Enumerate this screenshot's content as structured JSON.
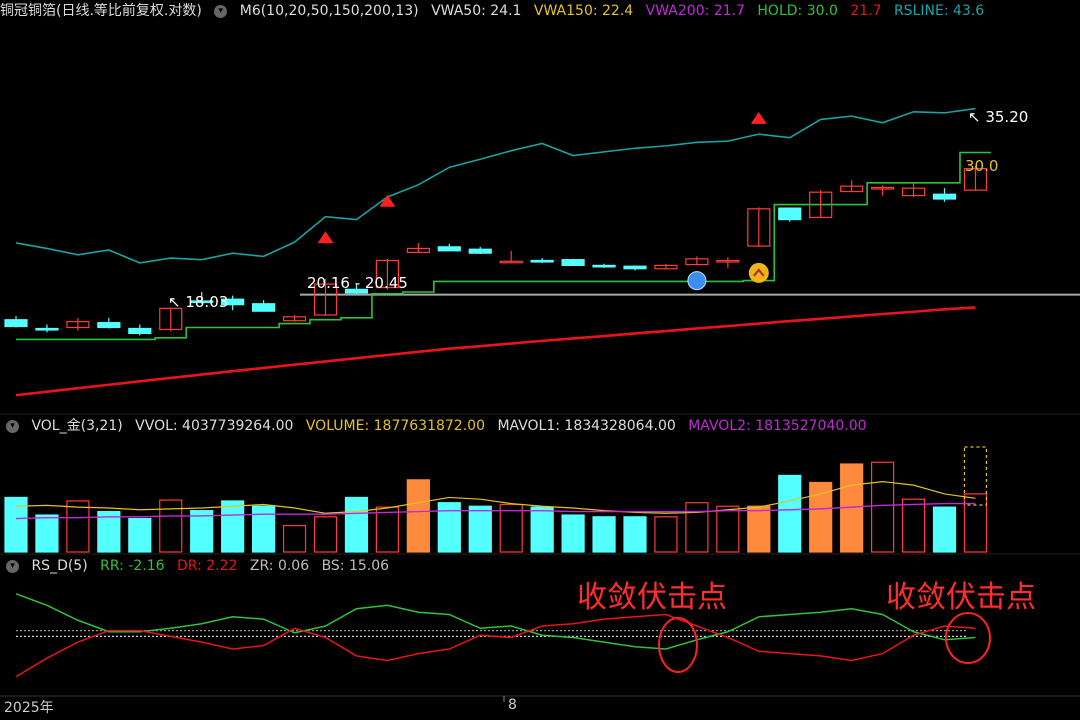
{
  "header_main": {
    "title": "铜冠铜箔(日线.等比前复权.对数)",
    "indicator": "M6(10,20,50,150,200,13)",
    "vwa50": "VWA50: 24.1",
    "vwa150": "VWA150: 22.4",
    "vwa200": "VWA200: 21.7",
    "hold": "HOLD: 30.0",
    "hold2": "21.7",
    "rsline": "RSLINE: 43.6"
  },
  "header_vol": {
    "name": "VOL_金(3,21)",
    "vvol": "VVOL: 4037739264.00",
    "volume": "VOLUME: 1877631872.00",
    "mavol1": "MAVOL1: 1834328064.00",
    "mavol2": "MAVOL2: 1813527040.00"
  },
  "header_rs": {
    "name": "RS_D(5)",
    "rr": "RR: -2.16",
    "dr": "DR: 2.22",
    "zr": "ZR: 0.06",
    "bs": "BS: 15.06"
  },
  "labels": {
    "low": "18.03",
    "range": "20.16 - 20.45",
    "high": "35.20",
    "hold_val": "30.0",
    "annotation1": "收敛伏击点",
    "annotation2": "收敛伏击点",
    "x_year": "2025年",
    "x_tick": "8"
  },
  "colors": {
    "up": "#ff3b3b",
    "down": "#54ffff",
    "hot": "#ff8a3d",
    "teal": "#1aa3a3",
    "green": "#2fc33a",
    "red": "#e8141a",
    "yellow": "#e6c31e",
    "purple": "#c02bd6",
    "grey": "#bdbdbd"
  },
  "chart_data": [
    {
      "type": "candlestick",
      "x": [
        1,
        2,
        3,
        4,
        5,
        6,
        7,
        8,
        9,
        10,
        11,
        12,
        13,
        14,
        15,
        16,
        17,
        18,
        19,
        20,
        21,
        22,
        23,
        24,
        25,
        26,
        27,
        28,
        29,
        30,
        31,
        32
      ],
      "ohlc": [
        [
          18.95,
          19.15,
          18.55,
          18.6
        ],
        [
          18.5,
          18.7,
          18.3,
          18.45
        ],
        [
          18.55,
          19.05,
          18.4,
          18.85
        ],
        [
          18.8,
          19.05,
          18.5,
          18.55
        ],
        [
          18.5,
          18.7,
          18.15,
          18.25
        ],
        [
          18.45,
          19.6,
          18.35,
          19.55
        ],
        [
          19.95,
          20.45,
          19.8,
          19.9
        ],
        [
          20.05,
          20.25,
          19.45,
          19.75
        ],
        [
          19.8,
          20.0,
          19.4,
          19.4
        ],
        [
          18.9,
          19.2,
          18.85,
          19.1
        ],
        [
          19.2,
          21.2,
          19.15,
          20.9
        ],
        [
          20.6,
          20.9,
          20.35,
          20.4
        ],
        [
          20.7,
          22.4,
          20.6,
          22.3
        ],
        [
          22.8,
          23.4,
          22.75,
          23.05
        ],
        [
          23.15,
          23.35,
          22.9,
          22.9
        ],
        [
          23.0,
          23.15,
          22.7,
          22.75
        ],
        [
          22.25,
          22.9,
          22.2,
          22.25
        ],
        [
          22.3,
          22.45,
          22.15,
          22.25
        ],
        [
          22.35,
          22.4,
          22.0,
          22.0
        ],
        [
          22.0,
          22.1,
          21.85,
          21.95
        ],
        [
          21.95,
          22.0,
          21.7,
          21.8
        ],
        [
          21.8,
          22.1,
          21.75,
          22.0
        ],
        [
          22.05,
          22.55,
          22.0,
          22.4
        ],
        [
          22.3,
          22.5,
          21.85,
          22.3
        ],
        [
          23.2,
          25.8,
          23.15,
          25.7
        ],
        [
          25.75,
          25.8,
          24.8,
          24.95
        ],
        [
          25.1,
          27.05,
          25.05,
          26.9
        ],
        [
          26.95,
          27.8,
          26.9,
          27.35
        ],
        [
          27.2,
          27.4,
          26.65,
          27.25
        ],
        [
          26.65,
          27.6,
          26.55,
          27.2
        ],
        [
          26.75,
          27.2,
          26.2,
          26.4
        ],
        [
          27.05,
          28.9,
          27.0,
          28.7
        ]
      ],
      "series": [
        {
          "name": "RSLINE",
          "values": [
            23.4,
            23.05,
            22.65,
            22.95,
            22.15,
            22.45,
            22.35,
            22.75,
            22.55,
            23.45,
            25.15,
            24.95,
            26.55,
            27.45,
            28.8,
            29.45,
            30.15,
            30.75,
            29.75,
            30.05,
            30.35,
            30.55,
            30.85,
            30.95,
            31.55,
            31.25,
            32.85,
            33.15,
            32.55,
            33.55,
            33.45,
            33.85
          ]
        },
        {
          "name": "HOLD",
          "values": [
            17.95,
            17.95,
            17.95,
            17.95,
            17.95,
            18.03,
            18.55,
            18.55,
            18.55,
            18.75,
            18.95,
            19.05,
            20.35,
            20.45,
            21.05,
            21.05,
            21.05,
            21.05,
            21.05,
            21.05,
            21.05,
            21.05,
            21.05,
            21.05,
            21.1,
            26.0,
            26.0,
            26.0,
            27.6,
            27.6,
            27.6,
            30.0
          ]
        },
        {
          "name": "VWA200",
          "values": [
            15.4,
            15.55,
            15.7,
            15.85,
            16.0,
            16.15,
            16.3,
            16.45,
            16.6,
            16.75,
            16.9,
            17.05,
            17.2,
            17.35,
            17.5,
            17.62,
            17.75,
            17.88,
            18.0,
            18.12,
            18.25,
            18.37,
            18.5,
            18.62,
            18.75,
            18.88,
            19.0,
            19.12,
            19.25,
            19.37,
            19.5,
            19.6
          ]
        }
      ],
      "annotations": [
        "18.03",
        "20.16 - 20.45",
        "35.20",
        "30.0"
      ]
    },
    {
      "type": "bar",
      "name": "VOL_金(3,21)",
      "values": [
        62,
        42,
        58,
        46,
        38,
        59,
        47,
        58,
        52,
        30,
        40,
        62,
        51,
        82,
        56,
        52,
        54,
        51,
        42,
        40,
        40,
        40,
        56,
        52,
        52,
        87,
        79,
        100,
        102,
        60,
        51,
        66
      ],
      "series": [
        {
          "name": "MAVOL1",
          "values": [
            52,
            53,
            51,
            50,
            48,
            49,
            50,
            52,
            54,
            50,
            44,
            46,
            50,
            56,
            62,
            60,
            55,
            52,
            50,
            47,
            45,
            44,
            45,
            48,
            51,
            58,
            66,
            76,
            80,
            76,
            66,
            61
          ]
        },
        {
          "name": "MAVOL2",
          "values": [
            38,
            39,
            39,
            40,
            40,
            41,
            41,
            42,
            43,
            43,
            43,
            44,
            45,
            46,
            47,
            47,
            47,
            47,
            46,
            46,
            46,
            46,
            46,
            47,
            47,
            48,
            49,
            51,
            53,
            54,
            55,
            55
          ]
        }
      ]
    },
    {
      "type": "line",
      "name": "RS_D(5)",
      "series": [
        {
          "name": "RR",
          "values": [
            88,
            78,
            65,
            55,
            55,
            58,
            62,
            68,
            66,
            54,
            60,
            75,
            78,
            72,
            70,
            58,
            60,
            52,
            50,
            46,
            42,
            40,
            48,
            55,
            68,
            70,
            72,
            75,
            70,
            55,
            48,
            50
          ]
        },
        {
          "name": "DR",
          "values": [
            16,
            32,
            46,
            56,
            56,
            51,
            46,
            40,
            43,
            58,
            50,
            34,
            30,
            36,
            40,
            52,
            50,
            60,
            62,
            66,
            68,
            70,
            60,
            50,
            38,
            36,
            34,
            30,
            36,
            52,
            60,
            58
          ]
        }
      ]
    }
  ]
}
